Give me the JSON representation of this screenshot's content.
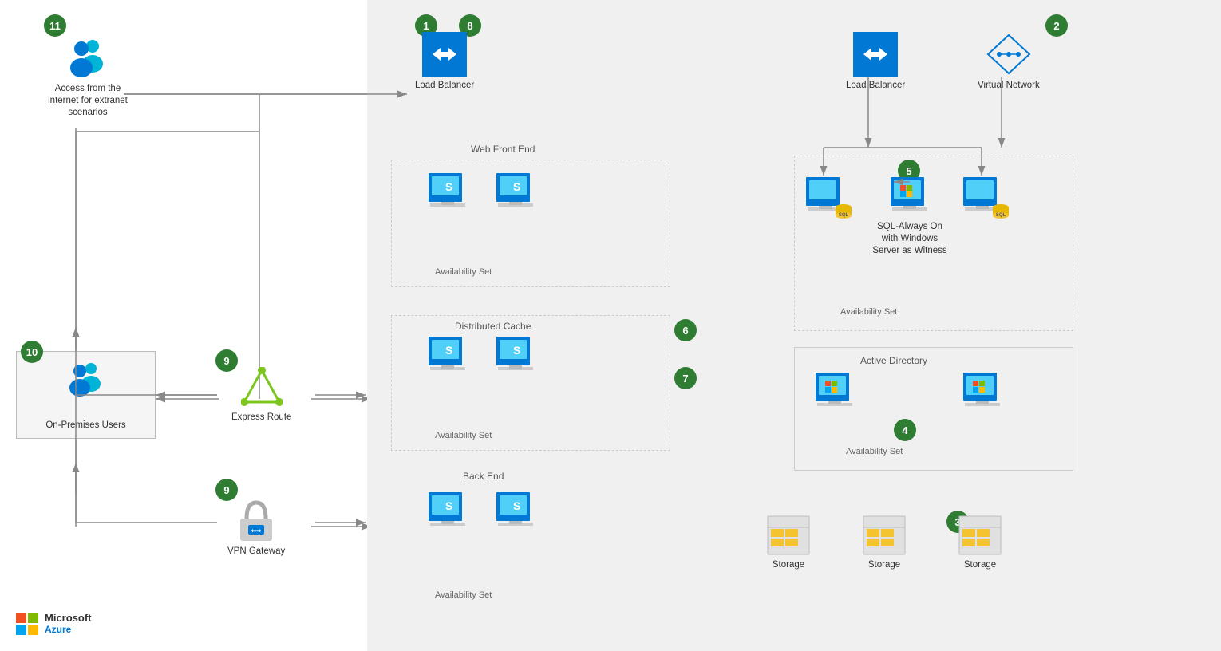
{
  "badges": {
    "b1": "1",
    "b2": "2",
    "b3": "3",
    "b4": "4",
    "b5": "5",
    "b6": "6",
    "b7": "7",
    "b8": "8",
    "b9a": "9",
    "b9b": "9",
    "b10": "10",
    "b11": "11"
  },
  "labels": {
    "lb1": "Load Balancer",
    "lb2": "Load Balancer",
    "vnet": "Virtual Network",
    "webFrontEnd": "Web Front End",
    "distributedCache": "Distributed Cache",
    "backEnd": "Back End",
    "availSet": "Availability Set",
    "sqlAlwaysOn": "SQL-Always On\nwith Windows Server\nas Witness",
    "activeDirectory": "Active Directory",
    "storage1": "Storage",
    "storage2": "Storage",
    "storage3": "Storage",
    "expressRoute": "Express Route",
    "vpnGateway": "VPN Gateway",
    "onPremUsers": "On-Premises Users",
    "internetAccess": "Access from the\ninternet for extranet\nscenarios",
    "azureLine1": "Microsoft",
    "azureLine2": "Azure"
  }
}
